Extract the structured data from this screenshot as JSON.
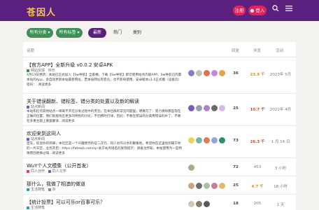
{
  "header": {
    "logo": "苍因人",
    "signup_label": "注册",
    "login_label": "登入",
    "login_icon": "user-icon",
    "search_icon": "search-icon",
    "menu_icon": "hamburger-menu-icon",
    "colors": {
      "bar": "#5b1f7d",
      "button": "#e0225d",
      "logo": "#f2c84b"
    }
  },
  "filters": {
    "categories_label": "所有分类",
    "tags_label": "所有标签",
    "tabs": [
      "最新",
      "热门",
      "类别"
    ],
    "active_tab": "最新"
  },
  "table": {
    "headers": {
      "topic": "话题",
      "replies": "回复",
      "views": "浏览",
      "activity": "活动"
    },
    "rows": [
      {
        "title": "【官方APP】全新升级 v0.0.2 安卓APK",
        "category": "网站反馈",
        "tag": "推荐",
        "cat_color": "#3f8f56",
        "excerpt": "4月13日更新：本站已正式加入【Sw导航】全家桶，下载【Sw导航】即可使用站点内嵌APP。Sw导航已内置本站的App，会自动更新本站最新网址，若本站网址有变化，也不影响使用。安卓版本v1.0正式版（设备云）  密码：..阅读更多",
        "replies": "36",
        "views": "23.9 千",
        "views_class": "hot",
        "activity": "2023年 5月"
      },
      {
        "title": "关于错误翻新、错标签、错分类的处置以及新的解读",
        "category": "站点新闻",
        "tag": "",
        "cat_color": "#7a5bbd",
        "excerpt": "本站和任何其他站点一样离不开在分发过程中的责任，在本社群的常见问题里，明确写了：努力清除那些现在正确的位置，我们就能找出更多的特别的讨论，不因费时打烊，因此：不要在错误的分类用错误的补丁，不要在多重主题上重复翻译...阅读更多",
        "replies": "25",
        "views": "10.7 千",
        "views_class": "hot2",
        "activity": "2022年 4月"
      },
      {
        "title": "欢迎来到这同人",
        "category": "站点新闻",
        "tag": "",
        "cat_color": "#7a5bbd",
        "excerpt": "首先，欢迎你的到来，本社区是一个兴趣使然的征二次元、同人创作分享的聚集地。希望你在这里找到属于你的一片天空。业务开启：https://fatewb.com/sp-关于站点域名的发现提示：请备注所知，本站使用为一些特殊原因更换过域...阅读更多",
        "replies": "73",
        "views": "26.3 千",
        "views_class": "hot2",
        "activity": "1 月 14 日"
      },
      {
        "title": "WuY个人文模集（公开首发）",
        "category": "同人创作",
        "tag": "同人文学",
        "cat_color": "#d83c7a",
        "excerpt": "",
        "replies": "72",
        "views": "453",
        "views_class": "gray",
        "activity": "3 小时"
      },
      {
        "title": "那什么，我做了相澳的做道",
        "category": "生活随笔",
        "tag": "杂",
        "cat_color": "#2f9fb5",
        "excerpt": "",
        "replies": "25",
        "views": "4.7 千",
        "views_class": "hot",
        "activity": "18 小时"
      },
      {
        "title": "【统计投票】可以可乐or百事可乐？",
        "category": "生活随笔",
        "tag": "",
        "cat_color": "#2f9fb5",
        "excerpt": "",
        "replies": "18",
        "views": "205",
        "views_class": "gray",
        "activity": "1 天"
      }
    ]
  }
}
